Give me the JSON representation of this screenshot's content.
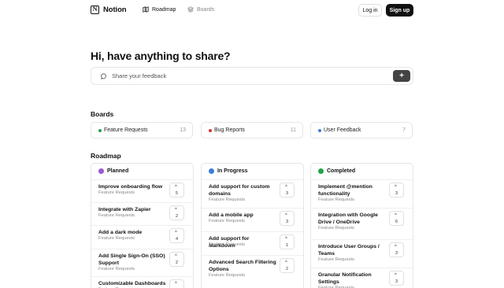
{
  "header": {
    "logo_text": "Notion",
    "logo_mark": "N",
    "nav": [
      {
        "label": "Roadmap",
        "icon": "map-icon"
      },
      {
        "label": "Boards",
        "icon": "layers-icon"
      }
    ],
    "login_label": "Log in",
    "signup_label": "Sign up"
  },
  "hero": {
    "title": "Hi, have anything to share?",
    "share_placeholder": "Share your feedback",
    "share_button": "+"
  },
  "boards": {
    "title": "Boards",
    "items": [
      {
        "label": "Feature Requests",
        "count": "13",
        "color": "#22a447"
      },
      {
        "label": "Bug Reports",
        "count": "11",
        "color": "#e03131"
      },
      {
        "label": "User Feedback",
        "count": "7",
        "color": "#3b7ddd"
      }
    ]
  },
  "roadmap": {
    "title": "Roadmap",
    "columns": [
      {
        "label": "Planned",
        "color": "#9b59d0",
        "items": [
          {
            "title": "Improve onboarding flow",
            "board": "Feature Requests",
            "votes": "5"
          },
          {
            "title": "Integrate with Zapier",
            "board": "Feature Requests",
            "votes": "2"
          },
          {
            "title": "Add a dark mode",
            "board": "Feature Requests",
            "votes": "4"
          },
          {
            "title": "Add Single Sign-On (SSO) Support",
            "board": "Feature Requests",
            "votes": "2"
          },
          {
            "title": "Customizable Dashboards",
            "board": "Feature Requests",
            "votes": ""
          }
        ]
      },
      {
        "label": "In Progress",
        "color": "#3b7ddd",
        "items": [
          {
            "title": "Add support for custom domains",
            "board": "Feature Requests",
            "votes": "3"
          },
          {
            "title": "Add a mobile app",
            "board": "Feature Requests",
            "votes": "3"
          },
          {
            "title": "Add support for Markdown",
            "board": "Feature Requests",
            "votes": "1"
          },
          {
            "title": "Advanced Search Filtering Options",
            "board": "Feature Requests",
            "votes": "2"
          }
        ]
      },
      {
        "label": "Completed",
        "color": "#22a447",
        "items": [
          {
            "title": "Implement @mention functionality",
            "board": "Feature Requests",
            "votes": "3"
          },
          {
            "title": "Integration with Google Drive / OneDrive",
            "board": "Feature Requests",
            "votes": "6"
          },
          {
            "title": "Introduce User Groups / Teams",
            "board": "Feature Requests",
            "votes": "3"
          },
          {
            "title": "Granular Notification Settings",
            "board": "Feature Requests",
            "votes": "3"
          }
        ]
      }
    ]
  }
}
